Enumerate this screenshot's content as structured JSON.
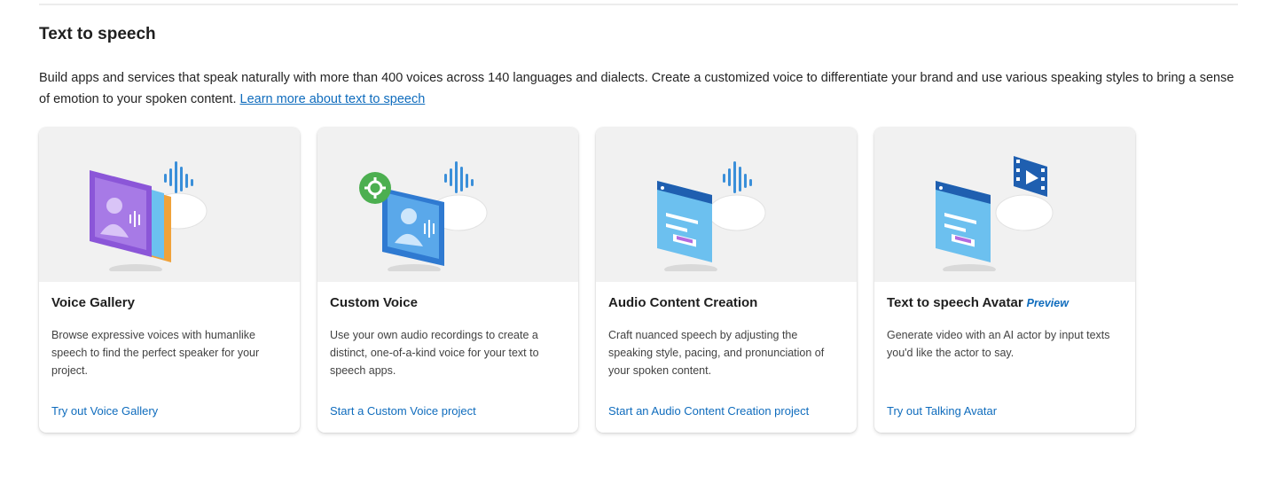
{
  "section": {
    "title": "Text to speech",
    "description": "Build apps and services that speak naturally with more than 400 voices across 140 languages and dialects. Create a customized voice to differentiate your brand and use various speaking styles to bring a sense of emotion to your spoken content.",
    "learn_more_link": "Learn more about text to speech"
  },
  "cards": [
    {
      "title": "Voice Gallery",
      "description": "Browse expressive voices with humanlike speech to find the perfect speaker for your project.",
      "link": "Try out Voice Gallery",
      "illustration": "voice-gallery-illustration"
    },
    {
      "title": "Custom Voice",
      "description": "Use your own audio recordings to create a distinct, one-of-a-kind voice for your text to speech apps.",
      "link": "Start a Custom Voice project",
      "illustration": "custom-voice-illustration"
    },
    {
      "title": "Audio Content Creation",
      "description": "Craft nuanced speech by adjusting the speaking style, pacing, and pronunciation of your spoken content.",
      "link": "Start an Audio Content Creation project",
      "illustration": "audio-content-creation-illustration"
    },
    {
      "title": "Text to speech Avatar",
      "badge": "Preview",
      "description": "Generate video with an AI actor by input texts you'd like the actor to say.",
      "link": "Try out Talking Avatar",
      "illustration": "talking-avatar-illustration"
    }
  ],
  "colors": {
    "link": "#0f6cbd",
    "card_media_bg": "#f1f1f1"
  }
}
